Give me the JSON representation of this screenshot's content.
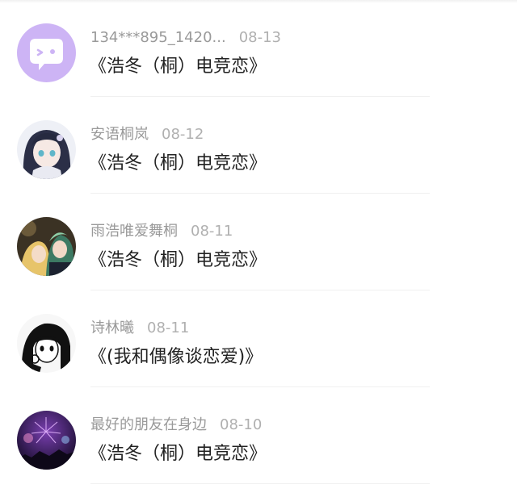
{
  "messages": [
    {
      "name": "134***895_1420...",
      "date": "08-13",
      "title": "《浩冬（桐）电竞恋》",
      "avatar_icon": "chat-bubble-face-icon",
      "avatar_color": "#c9aef4"
    },
    {
      "name": "安语桐岚",
      "date": "08-12",
      "title": "《浩冬（桐）电竞恋》",
      "avatar_icon": "anime-girl-portrait",
      "avatar_color": "#2a2f4a"
    },
    {
      "name": "雨浩唯爱舞桐",
      "date": "08-11",
      "title": "《浩冬（桐）电竞恋》",
      "avatar_icon": "anime-couple-portrait",
      "avatar_color": "#3b3222"
    },
    {
      "name": "诗林曦",
      "date": "08-11",
      "title": "《(我和偶像谈恋爱)》",
      "avatar_icon": "manga-girl-portrait",
      "avatar_color": "#111111"
    },
    {
      "name": "最好的朋友在身边",
      "date": "08-10",
      "title": "《浩冬（桐）电竞恋》",
      "avatar_icon": "fireworks-night-photo",
      "avatar_color": "#3a1f5c"
    }
  ]
}
